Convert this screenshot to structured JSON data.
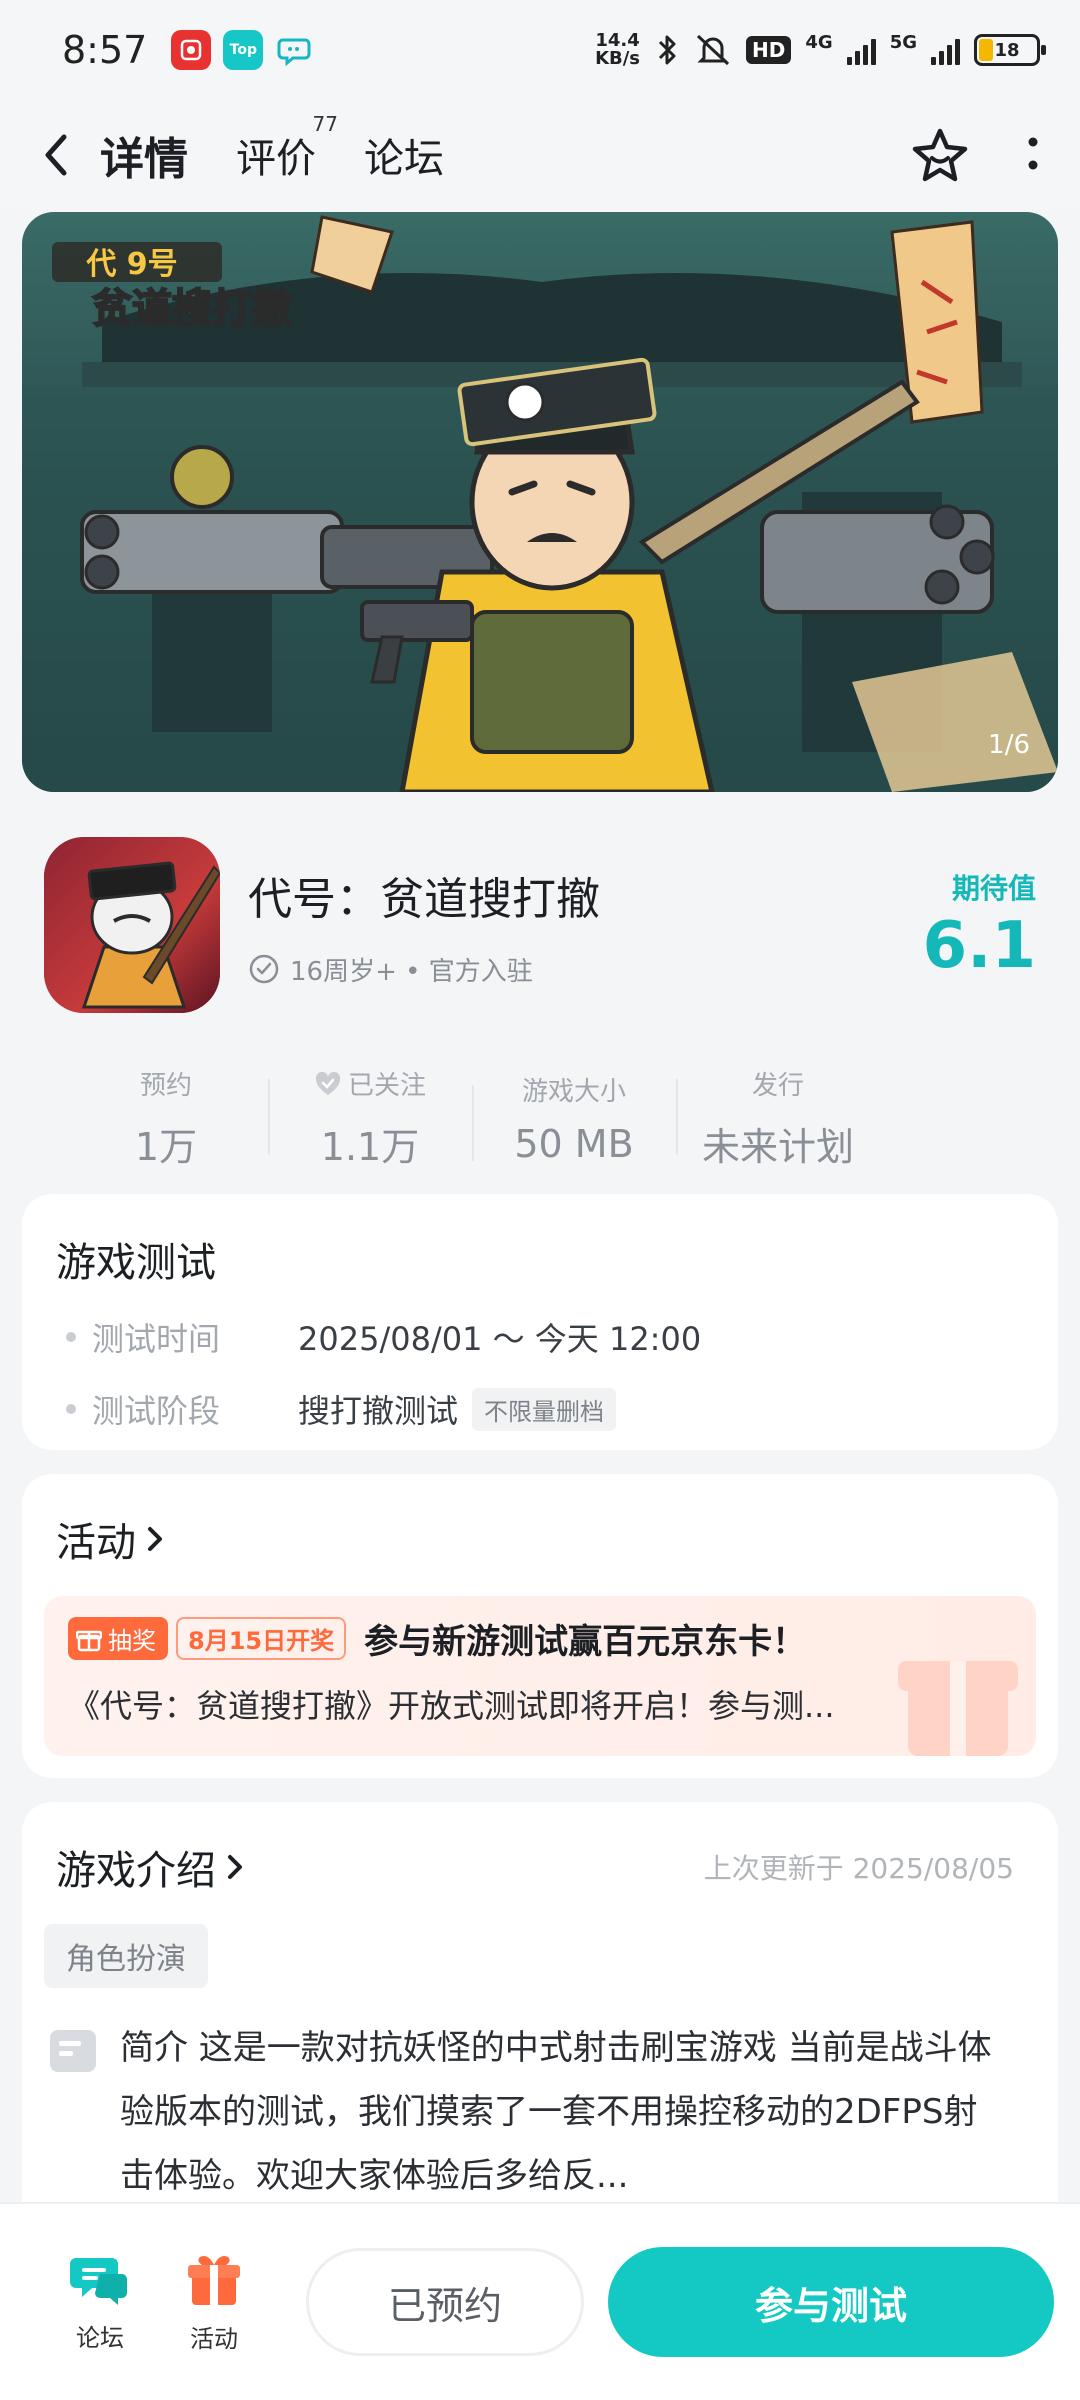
{
  "status_bar": {
    "time": "8:57",
    "net_speed_top": "14.4",
    "net_speed_unit": "KB/s",
    "hd_label": "HD",
    "net_4g": "4G",
    "net_5g": "5G",
    "battery": "18",
    "app_icons": [
      "red-app-icon",
      "taptap-icon",
      "chat-bubble-icon"
    ],
    "taptap_text": "Top"
  },
  "header": {
    "tabs": [
      {
        "label": "详情",
        "active": true
      },
      {
        "label": "评价",
        "count": "77"
      },
      {
        "label": "论坛"
      }
    ]
  },
  "banner": {
    "counter": "1/6"
  },
  "game": {
    "title": "代号：贫道搜打撤",
    "meta": "16周岁+ • 官方入驻",
    "expect_label": "期待值",
    "expect_value": "6.1"
  },
  "stats": [
    {
      "label": "预约",
      "value": "1万"
    },
    {
      "label": "已关注",
      "value": "1.1万"
    },
    {
      "label": "游戏大小",
      "value": "50 MB"
    },
    {
      "label": "发行",
      "value": "未来计划"
    }
  ],
  "test_section": {
    "title": "游戏测试",
    "rows": [
      {
        "key": "测试时间",
        "value": "2025/08/01 ～ 今天 12:00"
      },
      {
        "key": "测试阶段",
        "value": "搜打撤测试",
        "tag": "不限量删档"
      }
    ]
  },
  "activity": {
    "title": "活动",
    "lottery_tag": "抽奖",
    "date_tag": "8月15日开奖",
    "headline": "参与新游测试赢百元京东卡！",
    "description": "《代号：贫道搜打撤》开放式测试即将开启！参与测..."
  },
  "intro": {
    "title": "游戏介绍",
    "updated": "上次更新于 2025/08/05",
    "genre_tag": "角色扮演",
    "text": "简介 这是一款对抗妖怪的中式射击刷宝游戏 当前是战斗体验版本的测试，我们摸索了一套不用操控移动的2DFPS射击体验。欢迎大家体验后多给反..."
  },
  "bottom_bar": {
    "forum_label": "论坛",
    "activity_label": "活动",
    "reserved_label": "已预约",
    "join_label": "参与测试"
  },
  "colors": {
    "accent": "#14c9c3",
    "promo": "#ff6a3d",
    "page_bg": "#f3f5f7"
  }
}
